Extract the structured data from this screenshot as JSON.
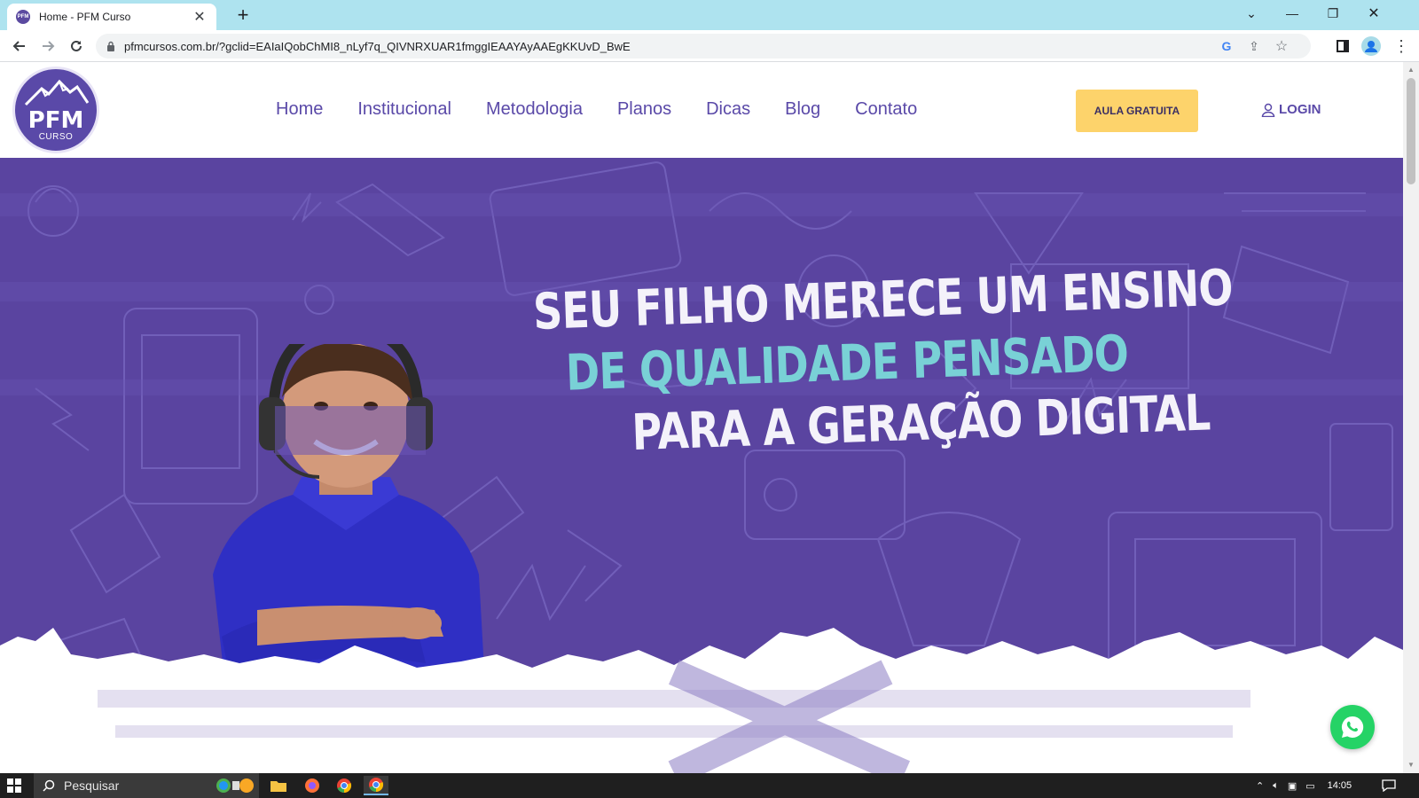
{
  "browser": {
    "tab_title": "Home - PFM Curso",
    "favicon_text": "PFM",
    "url": "pfmcursos.com.br/?gclid=EAIaIQobChMI8_nLyf7q_QIVNRXUAR1fmggIEAAYAyAAEgKKUvD_BwE",
    "icons": [
      "back-icon",
      "forward-icon",
      "reload-icon",
      "lock-icon",
      "google-icon",
      "share-icon",
      "star-icon",
      "side-panel-icon",
      "profile-icon",
      "kebab-menu-icon"
    ]
  },
  "site": {
    "logo": {
      "main": "PFM",
      "sub": "CURSO"
    },
    "menu": [
      {
        "label": "Home"
      },
      {
        "label": "Institucional"
      },
      {
        "label": "Metodologia"
      },
      {
        "label": "Planos"
      },
      {
        "label": "Dicas"
      },
      {
        "label": "Blog"
      },
      {
        "label": "Contato"
      }
    ],
    "cta_label": "AULA GRATUITA",
    "login_label": "LOGIN"
  },
  "hero": {
    "line1": "SEU FILHO MERECE UM ENSINO",
    "line2": "DE QUALIDADE PENSADO",
    "line3": "PARA A GERAÇÃO DIGITAL"
  },
  "colors": {
    "brand_purple": "#5a49a8",
    "hero_bg": "#5a44a0",
    "cta_yellow": "#fdd36b",
    "accent_teal": "#79d1d6",
    "whatsapp_green": "#25d366"
  },
  "taskbar": {
    "search_placeholder": "Pesquisar",
    "time": "14:05"
  }
}
